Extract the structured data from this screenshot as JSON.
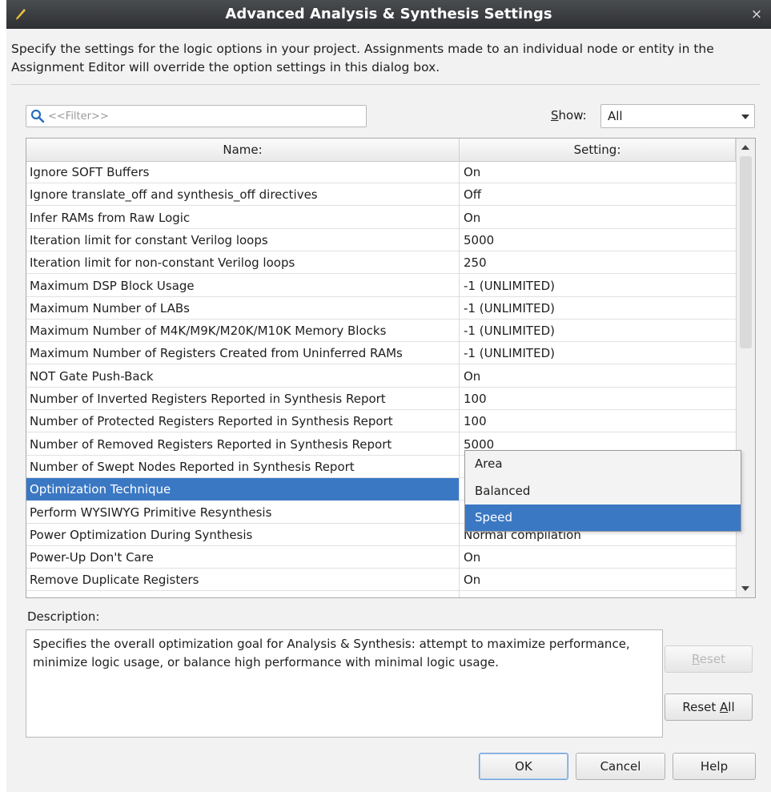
{
  "dialog": {
    "title": "Advanced Analysis & Synthesis Settings",
    "close_glyph": "×",
    "intro": "Specify the settings for the logic options in your project.  Assignments made to an individual node or entity in the Assignment Editor will override the option settings in this dialog box."
  },
  "filter": {
    "placeholder": "<<Filter>>",
    "icon": "search-icon"
  },
  "show": {
    "label_pre": "",
    "label_key": "S",
    "label_post": "how:",
    "value": "All"
  },
  "table": {
    "headers": {
      "name": "Name:",
      "setting": "Setting:"
    },
    "rows": [
      {
        "name": "Ignore SOFT Buffers",
        "setting": "On"
      },
      {
        "name": "Ignore translate_off and synthesis_off directives",
        "setting": "Off"
      },
      {
        "name": "Infer RAMs from Raw Logic",
        "setting": "On"
      },
      {
        "name": "Iteration limit for constant Verilog loops",
        "setting": "5000"
      },
      {
        "name": "Iteration limit for non-constant Verilog loops",
        "setting": "250"
      },
      {
        "name": "Maximum DSP Block Usage",
        "setting": "-1 (UNLIMITED)"
      },
      {
        "name": "Maximum Number of LABs",
        "setting": "-1 (UNLIMITED)"
      },
      {
        "name": "Maximum Number of M4K/M9K/M20K/M10K Memory Blocks",
        "setting": "-1 (UNLIMITED)"
      },
      {
        "name": "Maximum Number of Registers Created from Uninferred RAMs",
        "setting": "-1 (UNLIMITED)"
      },
      {
        "name": "NOT Gate Push-Back",
        "setting": "On"
      },
      {
        "name": "Number of Inverted Registers Reported in Synthesis Report",
        "setting": "100"
      },
      {
        "name": "Number of Protected Registers Reported in Synthesis Report",
        "setting": "100"
      },
      {
        "name": "Number of Removed Registers Reported in Synthesis Report",
        "setting": "5000"
      },
      {
        "name": "Number of Swept Nodes Reported in Synthesis Report",
        "setting": ""
      },
      {
        "name": "Optimization Technique",
        "setting": ""
      },
      {
        "name": "Perform WYSIWYG Primitive Resynthesis",
        "setting": ""
      },
      {
        "name": "Power Optimization During Synthesis",
        "setting": "Normal compilation"
      },
      {
        "name": "Power-Up Don't Care",
        "setting": "On"
      },
      {
        "name": "Remove Duplicate Registers",
        "setting": "On"
      }
    ]
  },
  "dropdown": {
    "options": [
      "Area",
      "Balanced",
      "Speed"
    ],
    "selected": "Speed"
  },
  "description": {
    "label": "Description:",
    "text": "Specifies the overall optimization goal for Analysis & Synthesis: attempt to maximize performance, minimize logic usage, or balance high performance with minimal logic usage."
  },
  "buttons": {
    "reset": {
      "pre": "",
      "key": "R",
      "post": "eset"
    },
    "reset_all": {
      "pre": "Reset ",
      "key": "A",
      "post": "ll"
    },
    "ok": "OK",
    "cancel": "Cancel",
    "help": "Help"
  },
  "colors": {
    "selection": "#3a78c4",
    "titlebar": "#2e3033"
  }
}
